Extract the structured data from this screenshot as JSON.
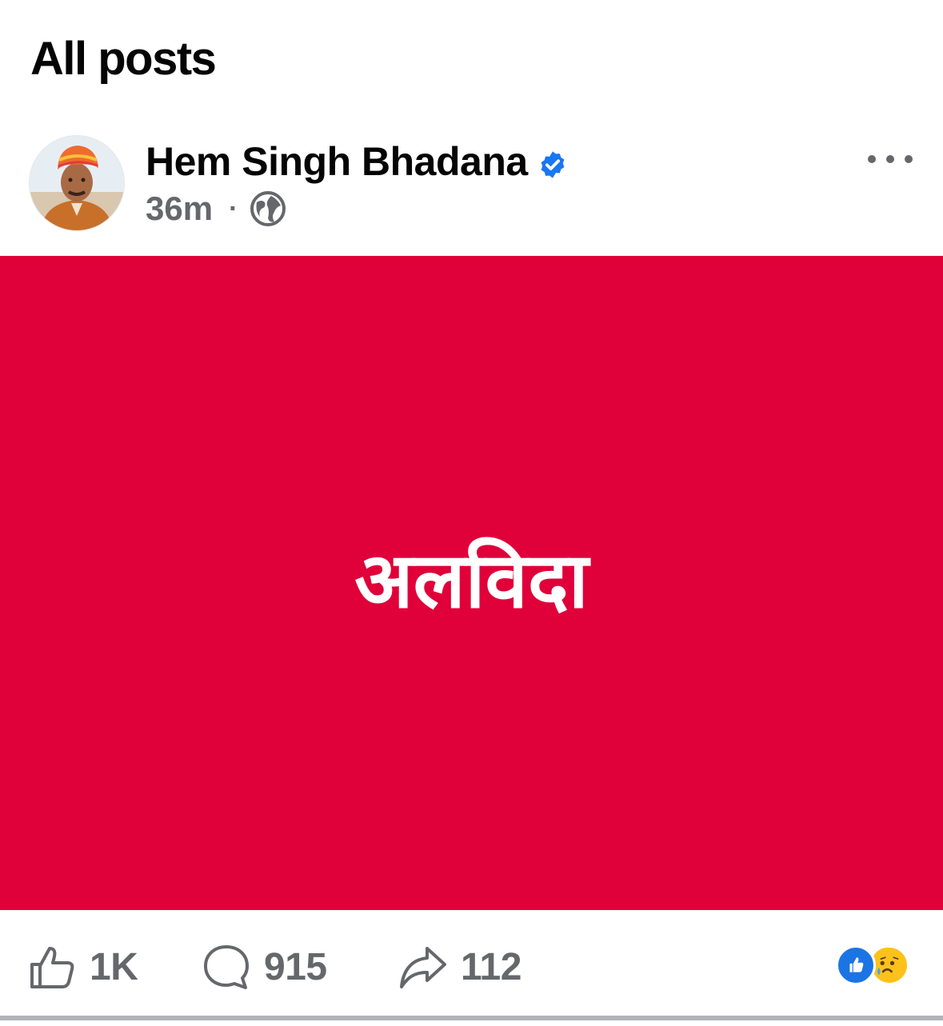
{
  "page": {
    "title": "All posts"
  },
  "post": {
    "author": "Hem Singh Bhadana",
    "timestamp": "36m",
    "separator": "·",
    "content_text": "अलविदा",
    "content_background": "#e0003a",
    "verified_icon": "verified-badge-icon",
    "audience_icon": "globe-icon",
    "menu_icon": "more-options-icon"
  },
  "actions": {
    "like": {
      "icon": "thumbs-up-icon",
      "count": "1K"
    },
    "comment": {
      "icon": "comment-bubble-icon",
      "count": "915"
    },
    "share": {
      "icon": "share-arrow-icon",
      "count": "112"
    }
  },
  "reactions": [
    "like",
    "sad"
  ],
  "colors": {
    "accent_blue": "#1877f2",
    "muted_text": "#65676b",
    "post_red": "#e0003a"
  }
}
